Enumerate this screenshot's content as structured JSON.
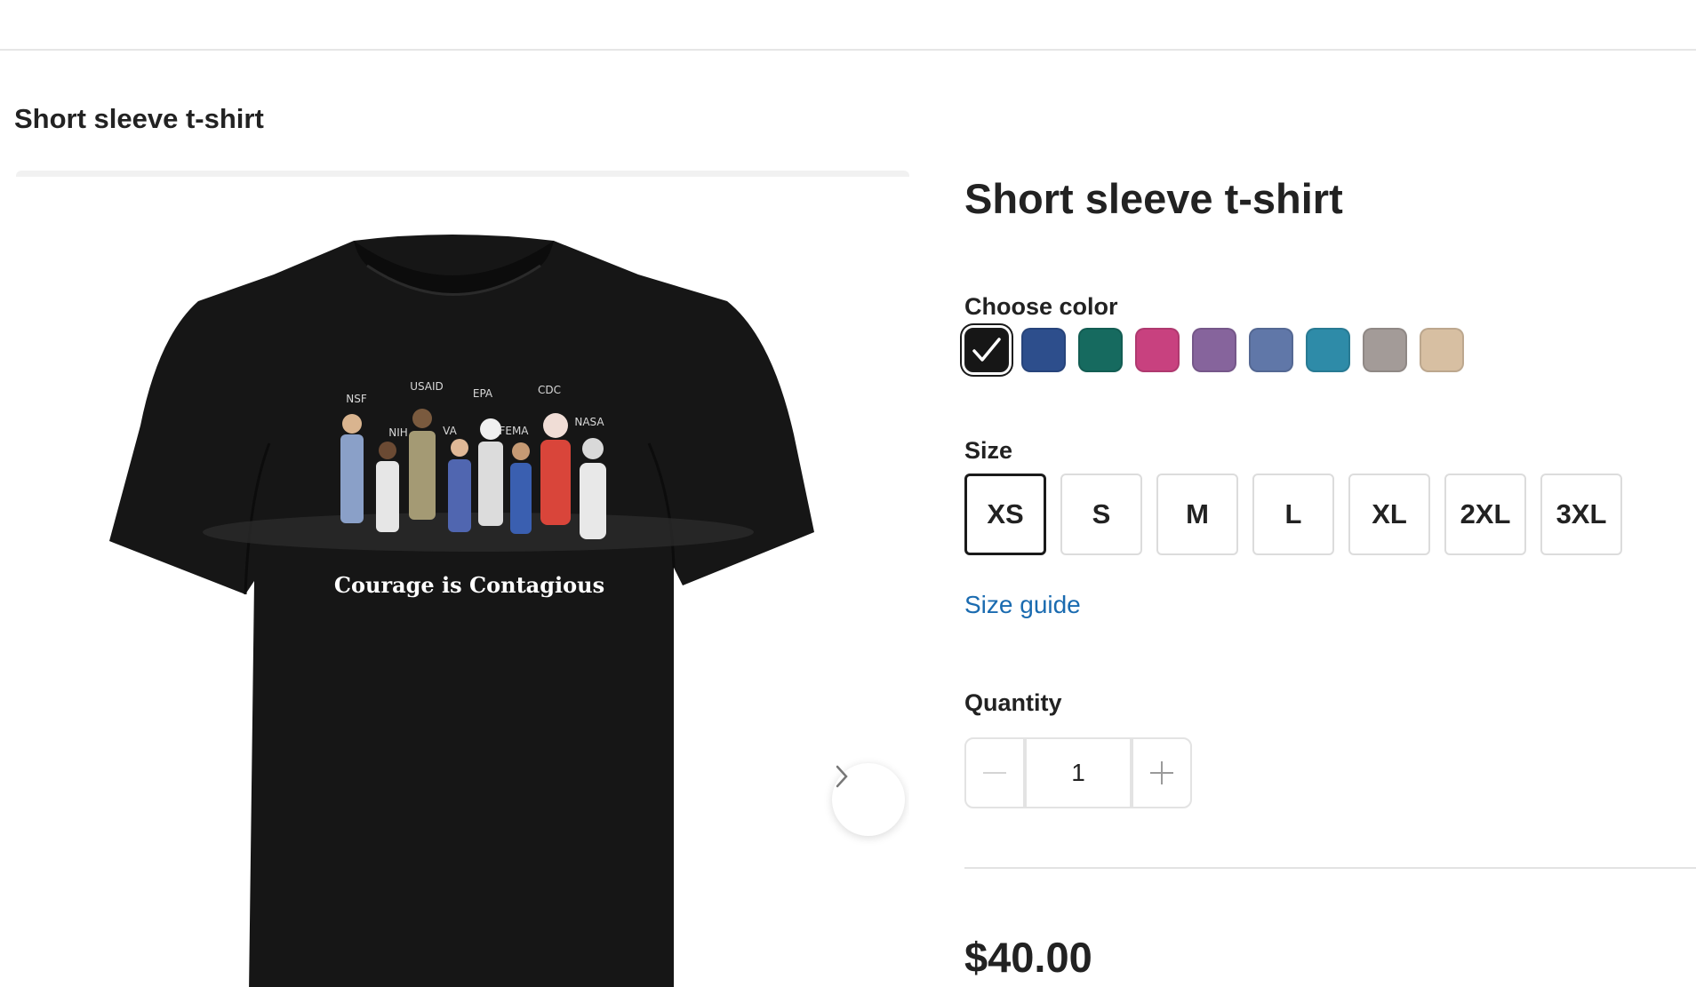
{
  "page": {
    "breadcrumb_title": "Short sleeve t-shirt"
  },
  "gallery": {
    "shirt_color": "#161616",
    "design_caption": "Courage is Contagious",
    "design_labels": [
      "NSF",
      "USAID",
      "NIH",
      "VA",
      "EPA",
      "FEMA",
      "CDC",
      "NASA"
    ],
    "next_icon": "chevron-right-icon"
  },
  "product": {
    "title": "Short sleeve t-shirt",
    "color_label": "Choose color",
    "colors": [
      {
        "hex": "#161616",
        "selected": true
      },
      {
        "hex": "#2d4e8c",
        "selected": false
      },
      {
        "hex": "#166a5f",
        "selected": false
      },
      {
        "hex": "#c8417f",
        "selected": false
      },
      {
        "hex": "#86649c",
        "selected": false
      },
      {
        "hex": "#6077a8",
        "selected": false
      },
      {
        "hex": "#2e8ba8",
        "selected": false
      },
      {
        "hex": "#a39b98",
        "selected": false
      },
      {
        "hex": "#d7bfa2",
        "selected": false
      }
    ],
    "size_label": "Size",
    "sizes": [
      "XS",
      "S",
      "M",
      "L",
      "XL",
      "2XL",
      "3XL"
    ],
    "selected_size": "XS",
    "size_guide": "Size guide",
    "quantity_label": "Quantity",
    "quantity": "1",
    "price": "$40.00"
  }
}
